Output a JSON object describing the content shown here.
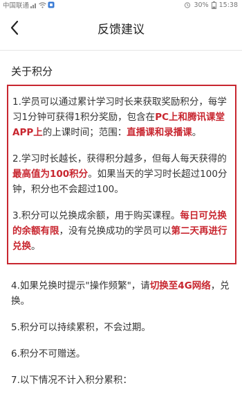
{
  "status_bar": {
    "carrier": "中国联通",
    "battery": "30%",
    "time": "15:38"
  },
  "header": {
    "title": "反馈建议",
    "back_icon": "chevron-left-icon"
  },
  "section": {
    "title": "关于积分"
  },
  "colors": {
    "highlight": "#c8262f",
    "box_border": "#c8262f"
  },
  "items": [
    {
      "t1": "1.学员可以通过累计学习时长来获取奖励积分，每学习1分钟可获得1积分奖励，包含在",
      "h1": "PC上和腾讯课堂APP上",
      "t2": "的上课时间；范围：",
      "h2": "直播课和录播课",
      "t3": "。"
    },
    {
      "t1": "2.学习时长越长，获得积分越多，但每人每天获得的",
      "h1": "最高值为100积分",
      "t2": "。如果当天的学习时长超过100分钟，积分也不会超过100。"
    },
    {
      "t1": "3.积分可以兑换成余额，用于购买课程。",
      "h1": "每日可兑换的余额有限",
      "t2": "，没有兑换成功的学员可以",
      "h2": "第二天再进行兑换",
      "t3": "。"
    },
    {
      "t1": "4.如果兑换时提示\"操作频繁\"，请",
      "h1": "切换至4G网络",
      "t2": "，兑换。"
    },
    {
      "t1": "5.积分可以持续累积，不会过期。"
    },
    {
      "t1": "6.积分不可赠送。"
    },
    {
      "t1": "7.以下情况不计入积分累积："
    }
  ]
}
